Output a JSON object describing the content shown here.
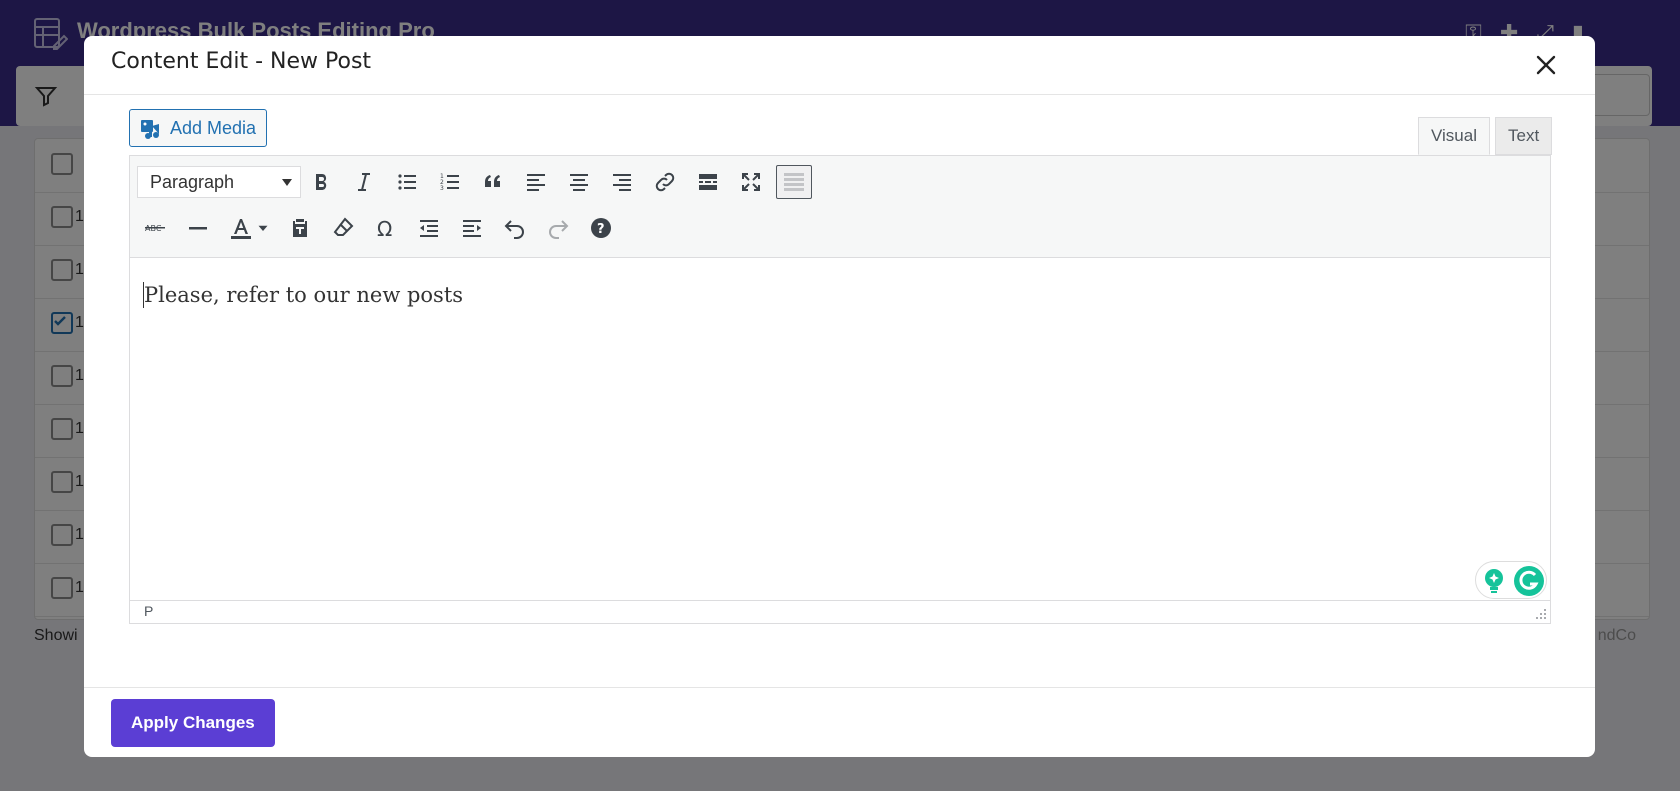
{
  "background_app": {
    "title": "Wordpress Bulk Posts Editing Pro",
    "footer_left": "Showi",
    "footer_right": "ndCo",
    "rows": [
      {
        "num": "1",
        "checked": false
      },
      {
        "num": "1",
        "checked": false
      },
      {
        "num": "1",
        "checked": true
      },
      {
        "num": "1",
        "checked": false
      },
      {
        "num": "1",
        "checked": false
      },
      {
        "num": "1",
        "checked": false
      },
      {
        "num": "1",
        "checked": false
      },
      {
        "num": "1",
        "checked": false
      }
    ]
  },
  "modal": {
    "title": "Content Edit - New Post",
    "add_media_label": "Add Media",
    "tabs": {
      "visual": "Visual",
      "text": "Text"
    },
    "format_select": "Paragraph",
    "content": "Please, refer to our new posts",
    "status_path": "P",
    "apply_button": "Apply Changes"
  },
  "colors": {
    "header_purple": "#3a2c8a",
    "apply_purple": "#5b3ed4",
    "link_blue": "#2271b1",
    "grammarly_green": "#15c39a"
  },
  "toolbar_row1": [
    "bold-icon",
    "italic-icon",
    "bullet-list-icon",
    "numbered-list-icon",
    "blockquote-icon",
    "align-left-icon",
    "align-center-icon",
    "align-right-icon",
    "link-icon",
    "read-more-icon",
    "fullscreen-icon",
    "toolbar-toggle-icon"
  ],
  "toolbar_row2": [
    "strikethrough-icon",
    "horizontal-line-icon",
    "text-color-icon",
    "paste-text-icon",
    "clear-formatting-icon",
    "special-character-icon",
    "outdent-icon",
    "indent-icon",
    "undo-icon",
    "redo-icon",
    "help-icon"
  ]
}
